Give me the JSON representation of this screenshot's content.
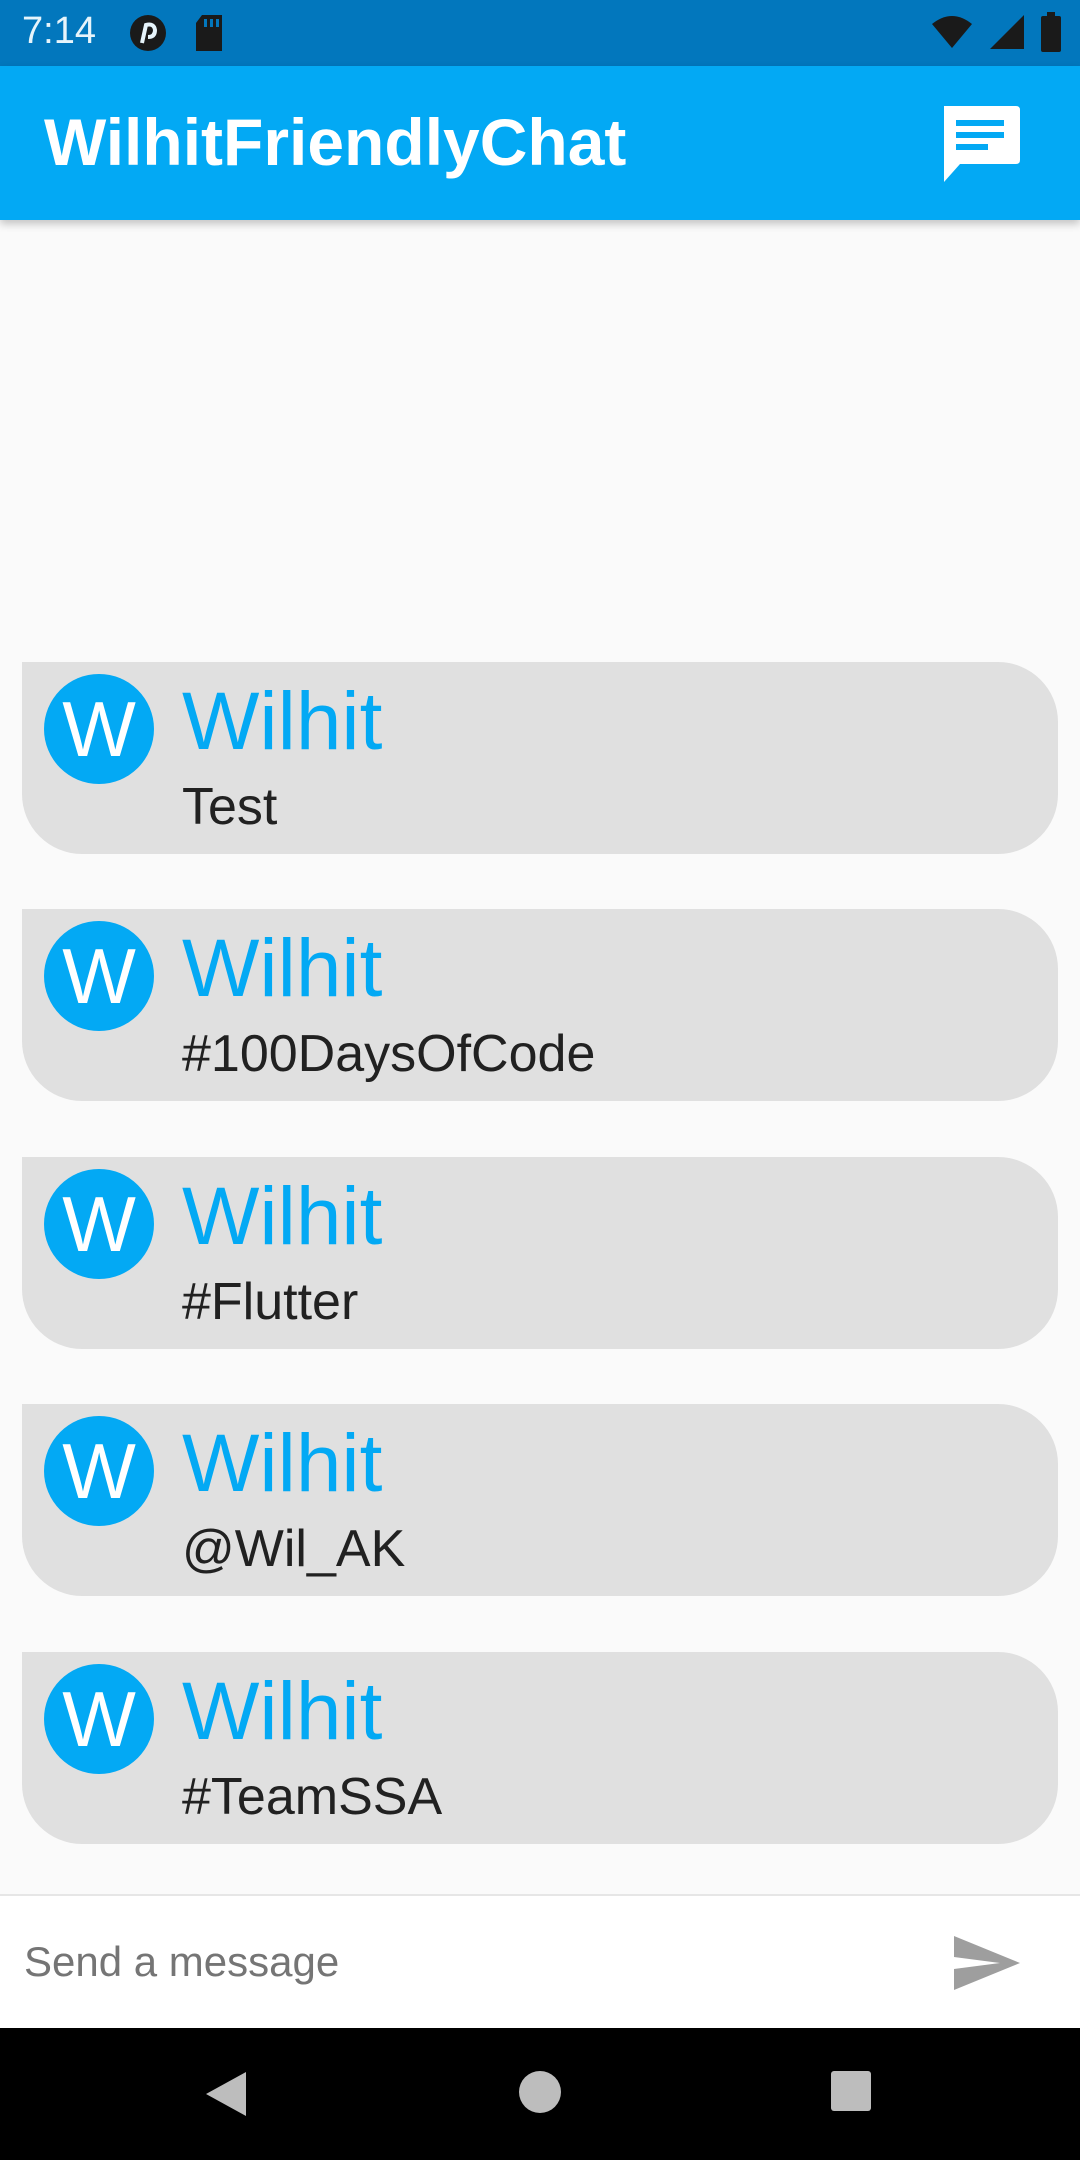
{
  "status_bar": {
    "time": "7:14",
    "icons": [
      "pinterest-icon",
      "sd-card-icon",
      "wifi-icon",
      "signal-icon",
      "battery-icon"
    ]
  },
  "app_bar": {
    "title": "WilhitFriendlyChat",
    "action_icon": "chat-icon",
    "color": "#03a9f4"
  },
  "messages": [
    {
      "avatar": "W",
      "name": "Wilhit",
      "text": "Test"
    },
    {
      "avatar": "W",
      "name": "Wilhit",
      "text": "#100DaysOfCode"
    },
    {
      "avatar": "W",
      "name": "Wilhit",
      "text": "#Flutter"
    },
    {
      "avatar": "W",
      "name": "Wilhit",
      "text": "@Wil_AK"
    },
    {
      "avatar": "W",
      "name": "Wilhit",
      "text": "#TeamSSA"
    }
  ],
  "composer": {
    "placeholder": "Send a message",
    "send_icon": "send-icon"
  },
  "nav_bar": {
    "icons": [
      "back-icon",
      "home-icon",
      "recents-icon"
    ]
  },
  "colors": {
    "accent": "#03a9f4",
    "status_bar": "#0277bd",
    "bubble": "#e0e0e0"
  }
}
